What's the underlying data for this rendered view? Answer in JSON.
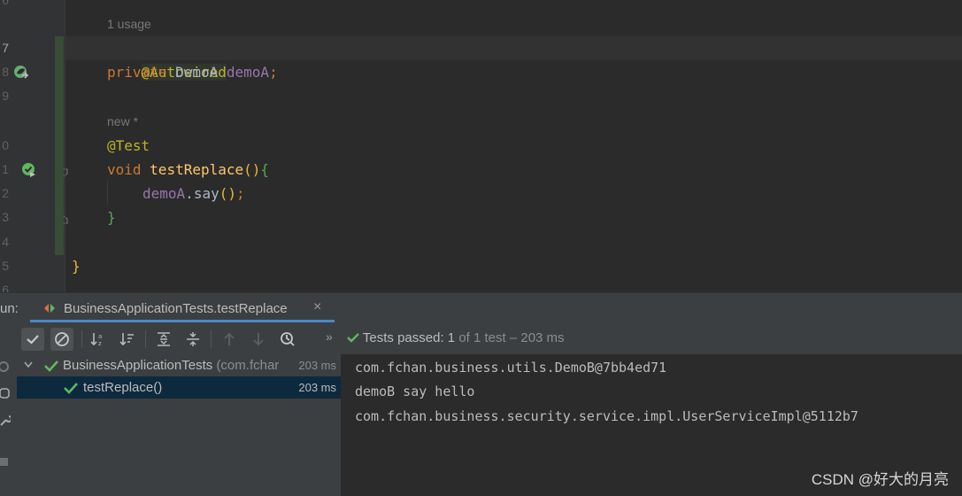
{
  "editor": {
    "line_numbers": [
      "6",
      "7",
      "8",
      "9",
      "0",
      "1",
      "2",
      "3",
      "4",
      "5",
      "6"
    ],
    "usage_hint": "1 usage",
    "author_hint": "new *",
    "lines": {
      "autowired": "@Autowired",
      "private_kw": "private",
      "field_type": "DemoA",
      "field_name": "demoA",
      "semicolon": ";",
      "test_ann": "@Test",
      "void_kw": "void",
      "method_name": "testReplace",
      "open_paren": "()",
      "open_brace": "{",
      "call_target": "demoA",
      "call_dot": ".",
      "call_method": "say",
      "call_paren": "()",
      "call_semicolon": ";",
      "close_brace_inner": "}",
      "close_brace_outer": "}"
    }
  },
  "run_panel": {
    "label": "un:",
    "tab_title": "BusinessApplicationTests.testReplace",
    "tab_close": "×",
    "overflow": "»",
    "status_passed": "Tests passed:",
    "status_count": "1",
    "status_rest": "of 1 test – 203 ms"
  },
  "tree": {
    "root": {
      "name": "BusinessApplicationTests",
      "pkg": "(com.fchar",
      "time": "203 ms"
    },
    "child": {
      "name": "testReplace()",
      "time": "203 ms"
    }
  },
  "console": {
    "lines": [
      "com.fchan.business.utils.DemoB@7bb4ed71",
      "demoB say hello",
      "com.fchan.business.security.service.impl.UserServiceImpl@5112b7"
    ]
  },
  "watermark": "CSDN @好大的月亮",
  "colors": {
    "pass_green": "#5fb85f",
    "selection": "#0d293e",
    "accent_blue": "#4a88c7"
  },
  "icons": [
    "spring-bean-icon",
    "run-test-icon",
    "check-icon",
    "stop-icon",
    "sort-alpha-icon",
    "sort-duration-icon",
    "expand-all-icon",
    "collapse-all-icon",
    "up-arrow-icon",
    "down-arrow-icon",
    "history-icon"
  ]
}
